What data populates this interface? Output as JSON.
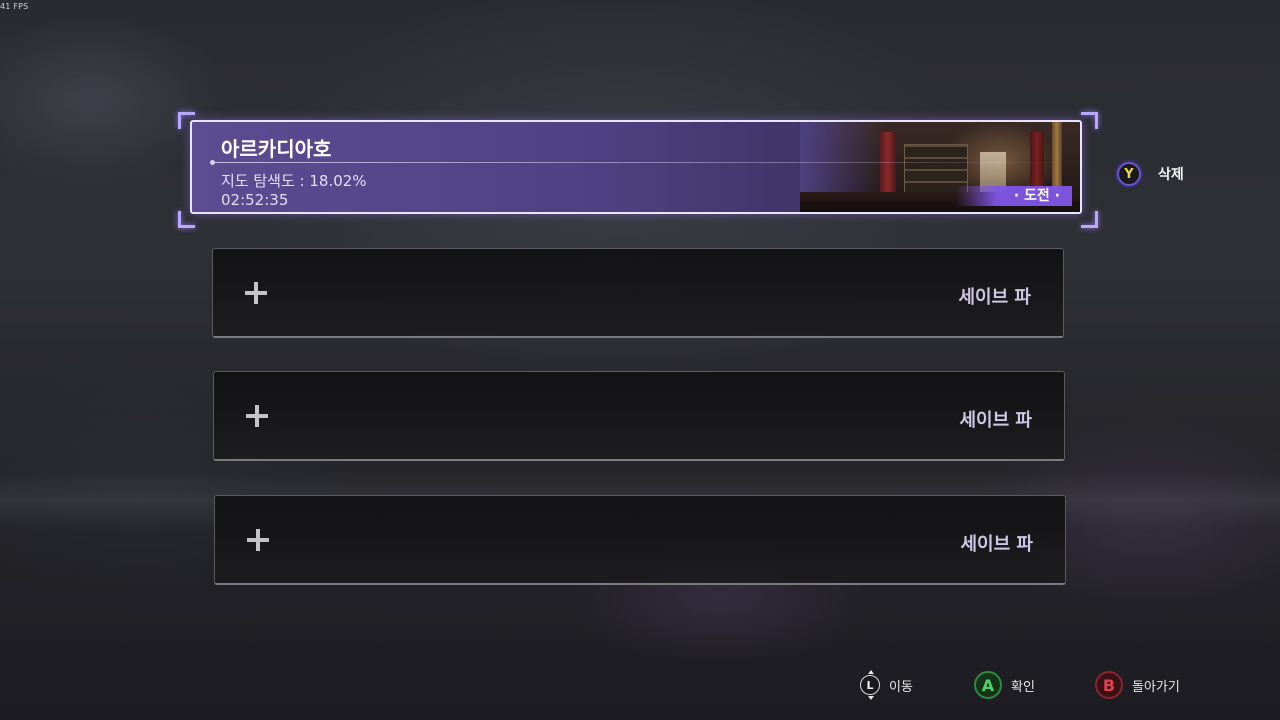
{
  "overlay": {
    "fps": "41 FPS"
  },
  "save_slots": {
    "selected": {
      "name": "아르카디아호",
      "progress": "지도 탐색도 : 18.02%",
      "playtime": "02:52:35",
      "difficulty_tag": "· 도전 ·"
    },
    "empty": [
      {
        "label": "세이브 파"
      },
      {
        "label": "세이브 파"
      },
      {
        "label": "세이브 파"
      }
    ]
  },
  "side_prompt": {
    "button": "Y",
    "label": "삭제"
  },
  "hints": [
    {
      "button": "L",
      "label": "이동",
      "icon": "left-stick-icon"
    },
    {
      "button": "A",
      "label": "확인",
      "icon": "a-button-icon"
    },
    {
      "button": "B",
      "label": "돌아가기",
      "icon": "b-button-icon"
    }
  ],
  "colors": {
    "accent": "#5c4c92",
    "selection_bracket": "#b9a8ff",
    "tag_purple": "#8056e6",
    "button_a": "#55d06a",
    "button_b": "#e0404e",
    "button_y": "#f0d24a"
  }
}
